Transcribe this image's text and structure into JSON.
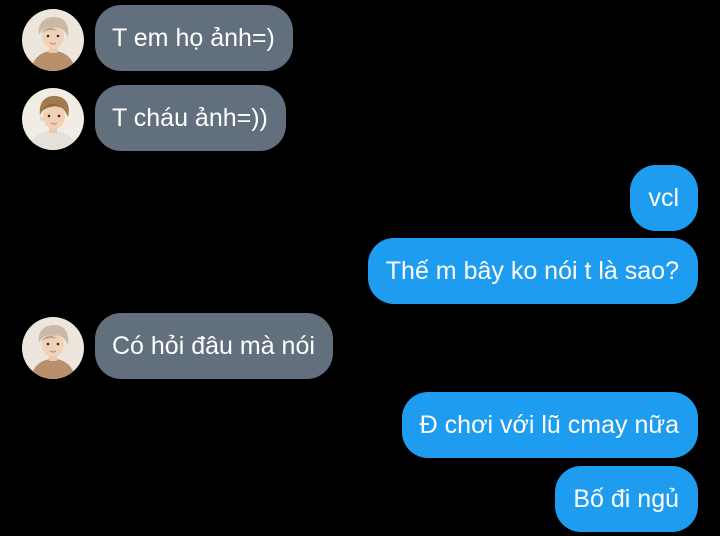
{
  "colors": {
    "background": "#000000",
    "incoming_bubble": "#626f7c",
    "outgoing_bubble": "#1e9cf0",
    "text": "#ffffff"
  },
  "messages": [
    {
      "direction": "incoming",
      "text": "T em họ ảnh=)",
      "avatar": "contact-avatar-a"
    },
    {
      "direction": "incoming",
      "text": "T cháu ảnh=))",
      "avatar": "contact-avatar-b"
    },
    {
      "direction": "outgoing",
      "text": "vcl"
    },
    {
      "direction": "outgoing",
      "text": "Thế m bây ko nói t là sao?"
    },
    {
      "direction": "incoming",
      "text": "Có hỏi đâu mà nói",
      "avatar": "contact-avatar-a"
    },
    {
      "direction": "outgoing",
      "text": "Đ chơi với lũ cmay nữa"
    },
    {
      "direction": "outgoing",
      "text": "Bố đi ngủ"
    }
  ]
}
